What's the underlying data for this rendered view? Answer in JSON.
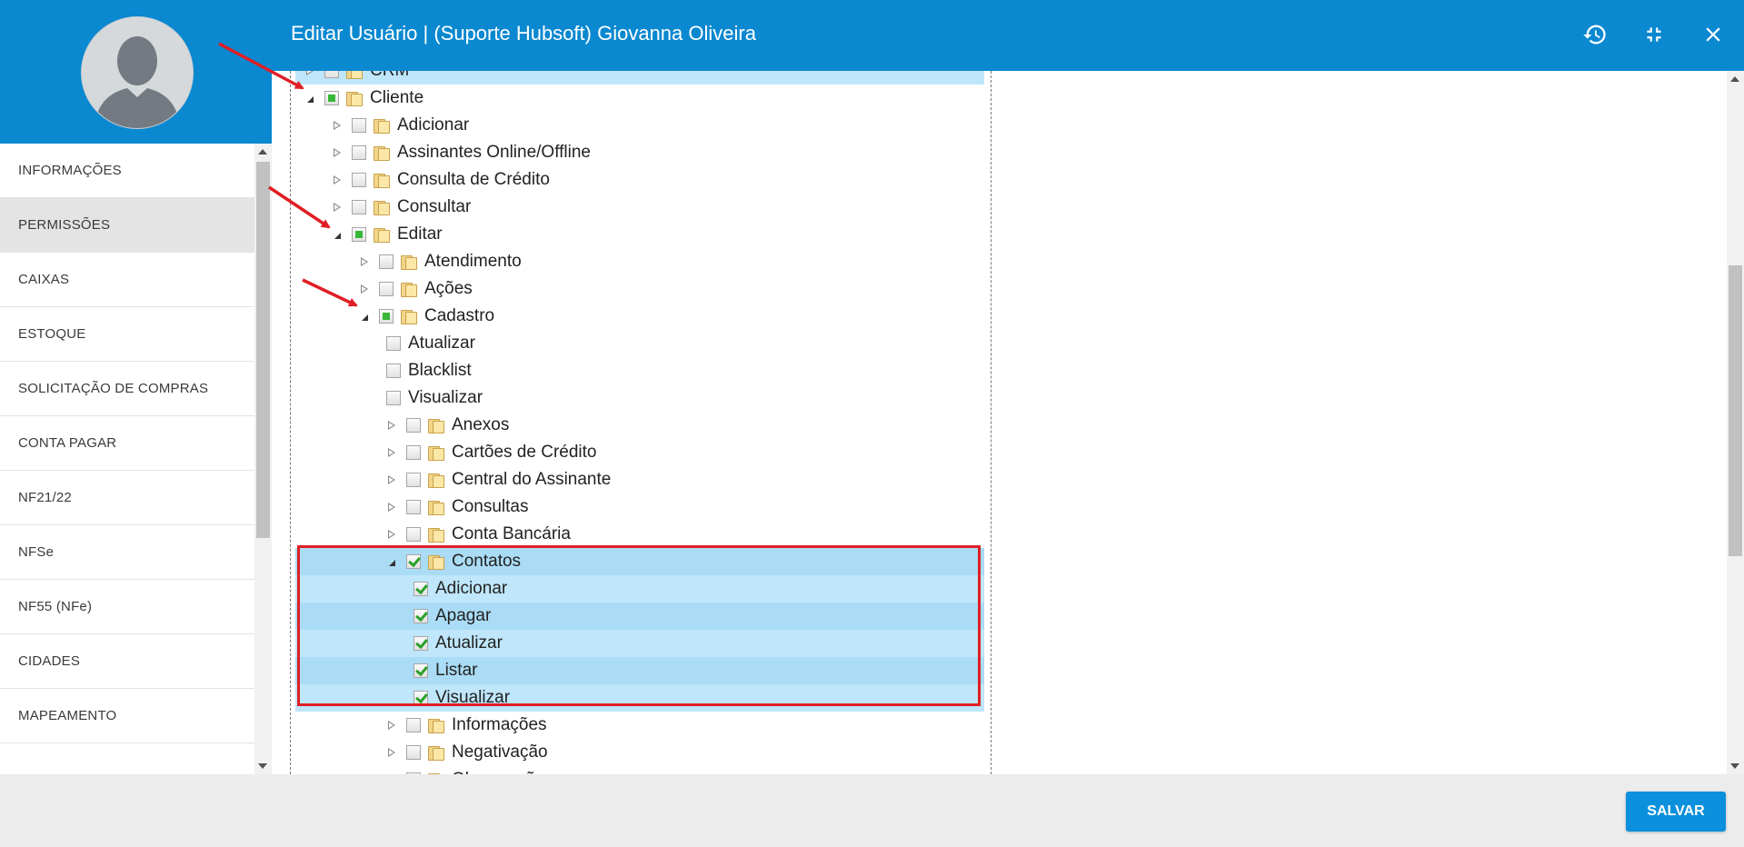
{
  "window": {
    "title": "Editar Usuário | (Suporte Hubsoft) Giovanna Oliveira"
  },
  "toolbar_icons": [
    "history-icon",
    "compress-icon",
    "close-icon"
  ],
  "sidebar": {
    "items": [
      {
        "label": "INFORMAÇÕES",
        "active": false
      },
      {
        "label": "PERMISSÕES",
        "active": true
      },
      {
        "label": "CAIXAS",
        "active": false
      },
      {
        "label": "ESTOQUE",
        "active": false
      },
      {
        "label": "SOLICITAÇÃO DE COMPRAS",
        "active": false
      },
      {
        "label": "CONTA PAGAR",
        "active": false
      },
      {
        "label": "NF21/22",
        "active": false
      },
      {
        "label": "NFSe",
        "active": false
      },
      {
        "label": "NF55 (NFe)",
        "active": false
      },
      {
        "label": "CIDADES",
        "active": false
      },
      {
        "label": "MAPEAMENTO",
        "active": false
      },
      {
        "label": "",
        "active": false
      }
    ]
  },
  "tree": {
    "nodes": [
      {
        "label": "CRM",
        "level": 0,
        "expander": "closed",
        "check": "none",
        "folder": true,
        "selected": "top"
      },
      {
        "label": "Cliente",
        "level": 0,
        "expander": "open",
        "check": "partial",
        "folder": true
      },
      {
        "label": "Adicionar",
        "level": 1,
        "expander": "closed",
        "check": "none",
        "folder": true
      },
      {
        "label": "Assinantes Online/Offline",
        "level": 1,
        "expander": "closed",
        "check": "none",
        "folder": true
      },
      {
        "label": "Consulta de Crédito",
        "level": 1,
        "expander": "closed",
        "check": "none",
        "folder": true
      },
      {
        "label": "Consultar",
        "level": 1,
        "expander": "closed",
        "check": "none",
        "folder": true
      },
      {
        "label": "Editar",
        "level": 1,
        "expander": "open",
        "check": "partial",
        "folder": true
      },
      {
        "label": "Atendimento",
        "level": 2,
        "expander": "closed",
        "check": "none",
        "folder": true
      },
      {
        "label": "Ações",
        "level": 2,
        "expander": "closed",
        "check": "none",
        "folder": true
      },
      {
        "label": "Cadastro",
        "level": 2,
        "expander": "open",
        "check": "partial",
        "folder": true
      },
      {
        "label": "Atualizar",
        "level": 3,
        "expander": "leaf",
        "check": "none",
        "folder": false
      },
      {
        "label": "Blacklist",
        "level": 3,
        "expander": "leaf",
        "check": "none",
        "folder": false
      },
      {
        "label": "Visualizar",
        "level": 3,
        "expander": "leaf",
        "check": "none",
        "folder": false
      },
      {
        "label": "Anexos",
        "level": 3,
        "expander": "closed",
        "check": "none",
        "folder": true
      },
      {
        "label": "Cartões de Crédito",
        "level": 3,
        "expander": "closed",
        "check": "none",
        "folder": true
      },
      {
        "label": "Central do Assinante",
        "level": 3,
        "expander": "closed",
        "check": "none",
        "folder": true
      },
      {
        "label": "Consultas",
        "level": 3,
        "expander": "closed",
        "check": "none",
        "folder": true
      },
      {
        "label": "Conta Bancária",
        "level": 3,
        "expander": "closed",
        "check": "none",
        "folder": true
      },
      {
        "label": "Contatos",
        "level": 3,
        "expander": "open",
        "check": "checked",
        "folder": true,
        "selected": "sel"
      },
      {
        "label": "Adicionar",
        "level": 4,
        "expander": "leaf",
        "check": "checked",
        "folder": false,
        "selected": "alt"
      },
      {
        "label": "Apagar",
        "level": 4,
        "expander": "leaf",
        "check": "checked",
        "folder": false,
        "selected": "sel"
      },
      {
        "label": "Atualizar",
        "level": 4,
        "expander": "leaf",
        "check": "checked",
        "folder": false,
        "selected": "alt"
      },
      {
        "label": "Listar",
        "level": 4,
        "expander": "leaf",
        "check": "checked",
        "folder": false,
        "selected": "sel"
      },
      {
        "label": "Visualizar",
        "level": 4,
        "expander": "leaf",
        "check": "checked",
        "folder": false,
        "selected": "alt"
      },
      {
        "label": "Informações",
        "level": 3,
        "expander": "closed",
        "check": "none",
        "folder": true
      },
      {
        "label": "Negativação",
        "level": 3,
        "expander": "closed",
        "check": "none",
        "folder": true
      },
      {
        "label": "Observação",
        "level": 3,
        "expander": "closed",
        "check": "none",
        "folder": true
      }
    ]
  },
  "footer": {
    "save_label": "SALVAR"
  },
  "colors": {
    "primary": "#0a88d0",
    "highlight_border": "#e01e25",
    "selection": "#aadcf6",
    "annotation_arrow": "#e01e25"
  }
}
